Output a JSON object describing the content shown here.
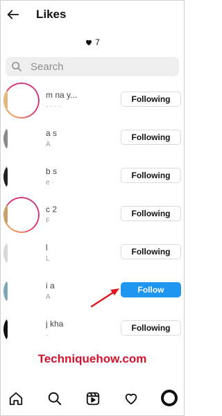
{
  "header": {
    "title": "Likes"
  },
  "likes": {
    "count": "7"
  },
  "search": {
    "placeholder": "Search"
  },
  "rows": [
    {
      "user": "m      na      y...",
      "sub": "·  ·        ·      ·",
      "button": "Following"
    },
    {
      "user": "a      s",
      "sub": "A",
      "button": "Following"
    },
    {
      "user": "b      s",
      "sub": "e   ·",
      "button": "Following"
    },
    {
      "user": "c      2",
      "sub": "F",
      "button": "Following"
    },
    {
      "user": "l",
      "sub": "L",
      "button": "Following"
    },
    {
      "user": "i       a",
      "sub": "A",
      "button": "Follow"
    },
    {
      "user": "j       kha",
      "sub": "·",
      "button": "Following"
    }
  ],
  "watermark": "Techniquehow.com",
  "colors": {
    "follow_blue": "#1f97f0",
    "story_gradient": "#e1306c",
    "watermark": "#d0122d"
  },
  "nav": {
    "icons": [
      "home-icon",
      "search-icon",
      "reels-icon",
      "heart-icon",
      "profile-avatar"
    ]
  }
}
